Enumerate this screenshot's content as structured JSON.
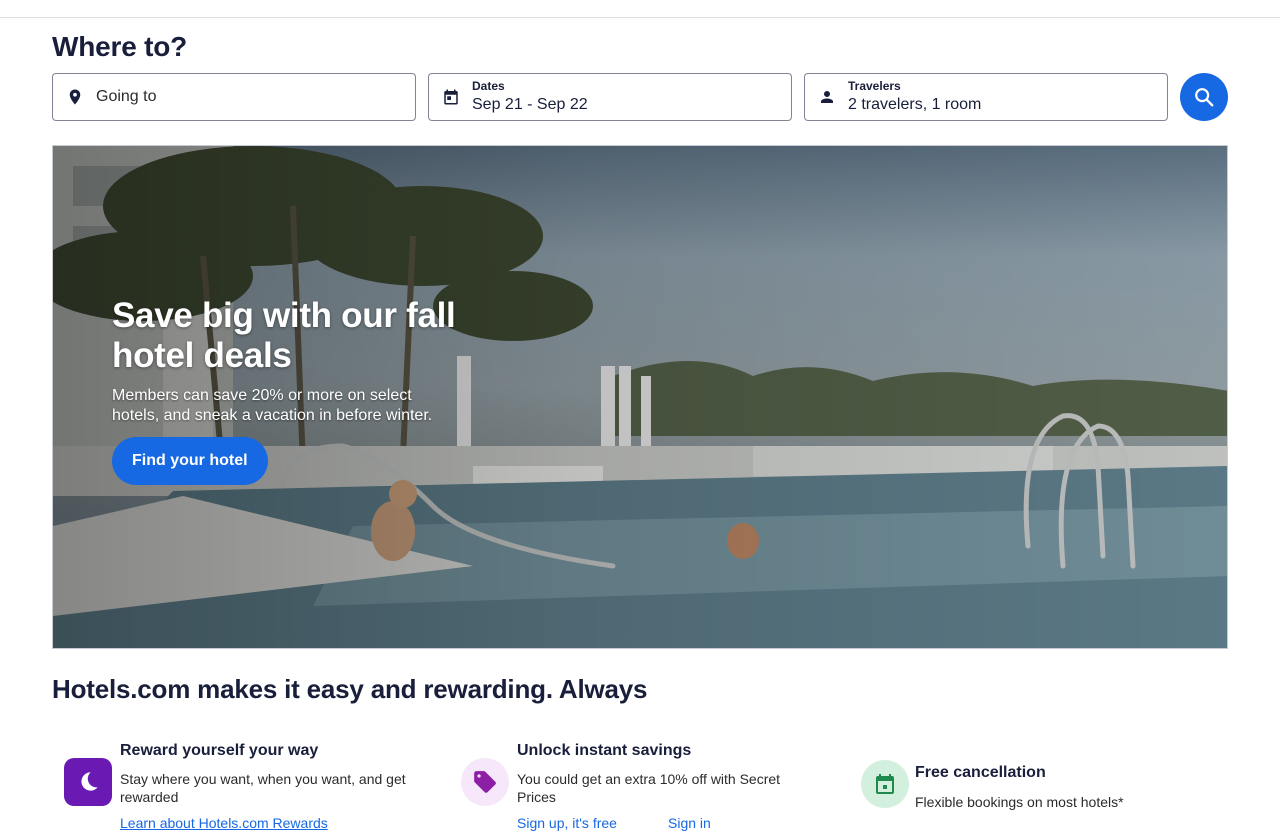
{
  "search": {
    "title": "Where to?",
    "destination_placeholder": "Going to",
    "dates_label": "Dates",
    "dates_value": "Sep 21 - Sep 22",
    "travelers_label": "Travelers",
    "travelers_value": "2 travelers, 1 room",
    "icons": {
      "destination": "map-pin-icon",
      "dates": "calendar-icon",
      "travelers": "person-icon",
      "search": "search-icon"
    }
  },
  "hero": {
    "title": "Save big with our fall hotel deals",
    "subtitle": "Members can save 20% or more on select hotels, and sneak a vacation in before winter.",
    "cta_label": "Find your hotel"
  },
  "benefits": {
    "title": "Hotels.com makes it easy and rewarding. Always",
    "items": [
      {
        "icon": "moon-icon",
        "title": "Reward yourself your way",
        "description": "Stay where you want, when you want, and get rewarded",
        "link": "Learn about Hotels.com Rewards"
      },
      {
        "icon": "tag-icon",
        "title": "Unlock instant savings",
        "description": "You could get an extra 10% off with Secret Prices",
        "link": "Sign up, it's free",
        "link2": "Sign in"
      },
      {
        "icon": "calendar-check-icon",
        "title": "Free cancellation",
        "description": "Flexible bookings on most hotels*"
      }
    ]
  },
  "colors": {
    "primary": "#1668e3",
    "heading": "#191e3b",
    "rewards_purple": "#6a1ab3",
    "savings_tint": "#f6e7fb",
    "cancel_tint": "#d3f0df",
    "cancel_green": "#1f8a4c"
  }
}
